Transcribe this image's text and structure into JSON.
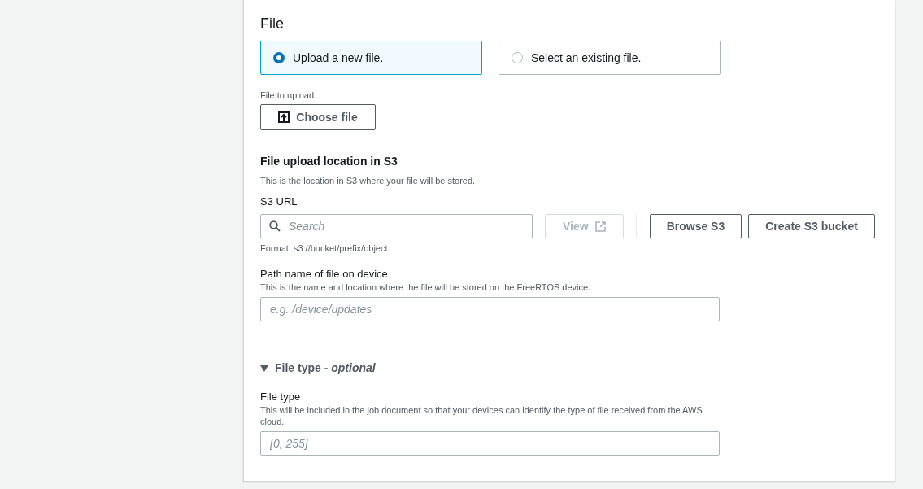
{
  "section": {
    "title": "File",
    "source_options": [
      {
        "label": "Upload a new file.",
        "selected": true
      },
      {
        "label": "Select an existing file.",
        "selected": false
      }
    ],
    "upload_label": "File to upload",
    "choose_button": "Choose file",
    "location": {
      "title": "File upload location in S3",
      "description": "This is the location in S3 where your file will be stored.",
      "s3_url": {
        "label": "S3 URL",
        "placeholder": "Search",
        "hint": "Format: s3://bucket/prefix/object."
      },
      "buttons": [
        {
          "label": "View",
          "kind": "external",
          "disabled": true
        },
        {
          "label": "Browse S3",
          "kind": "plain",
          "disabled": false
        },
        {
          "label": "Create S3 bucket",
          "kind": "plain",
          "disabled": false
        }
      ]
    },
    "path": {
      "label": "Path name of file on device",
      "description": "This is the name and location where the file will be stored on the FreeRTOS device.",
      "placeholder": "e.g. /device/updates"
    }
  },
  "file_type_panel": {
    "header": "File type - *optional*",
    "expanded": true,
    "field": {
      "label": "File type",
      "description": "This will be included in the job document so that your devices can identify the type of file received from the AWS cloud.",
      "placeholder": "[0, 255]"
    }
  }
}
